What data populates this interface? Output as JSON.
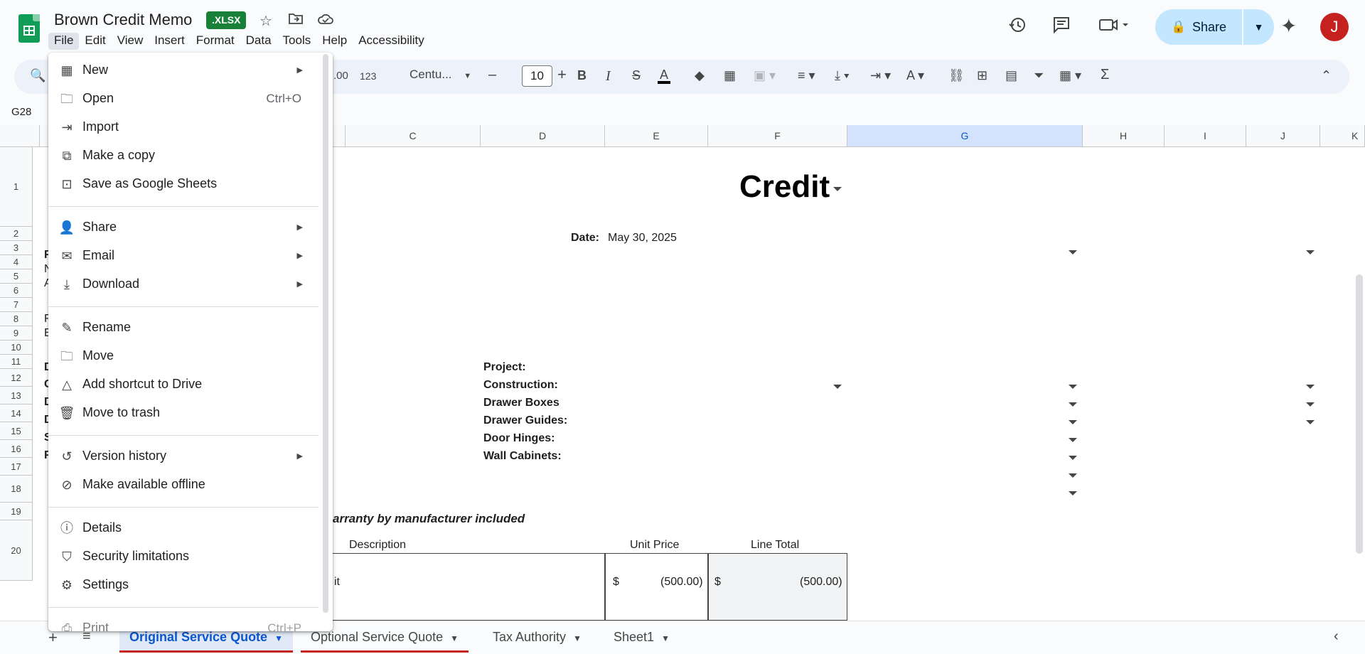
{
  "app": {
    "doc_title": "Brown Credit Memo",
    "format_badge": ".XLSX",
    "avatar_letter": "J",
    "share_label": "Share"
  },
  "menubar": [
    "File",
    "Edit",
    "View",
    "Insert",
    "Format",
    "Data",
    "Tools",
    "Help",
    "Accessibility"
  ],
  "toolbar": {
    "font_name": "Centu...",
    "font_size": "10",
    "number_format_label": "123",
    "decimal_label": ".00"
  },
  "namebox": "G28",
  "columns": [
    "C",
    "D",
    "E",
    "F",
    "G",
    "H",
    "I",
    "J",
    "K"
  ],
  "rows": [
    "1",
    "2",
    "3",
    "4",
    "5",
    "6",
    "7",
    "8",
    "9",
    "10",
    "11",
    "12",
    "13",
    "14",
    "15",
    "16",
    "17",
    "18",
    "19",
    "20"
  ],
  "sheet": {
    "title": "Credit",
    "date_label": "Date:",
    "date_value": "May 30, 2025",
    "fields": [
      "Project:",
      "Construction:",
      "Drawer Boxes",
      "Drawer Guides:",
      "Door Hinges:",
      "Wall Cabinets:"
    ],
    "warranty_note": "arranty by manufacturer included",
    "table_headers": [
      "Description",
      "Unit Price",
      "Line Total"
    ],
    "row20": {
      "desc_fragment": "it",
      "unit_currency": "$",
      "unit_value": "(500.00)",
      "line_currency": "$",
      "line_value": "(500.00)"
    },
    "left_fragments": [
      "F",
      "N",
      "A",
      "F",
      "E",
      "D",
      "C",
      "D",
      "D",
      "S",
      "F"
    ]
  },
  "tabs": [
    "Original Service Quote",
    "Optional Service Quote",
    "Tax Authority",
    "Sheet1"
  ],
  "file_menu": {
    "items": [
      {
        "label": "New",
        "icon": "new-sheet-icon",
        "submenu": true
      },
      {
        "label": "Open",
        "icon": "folder-icon",
        "shortcut": "Ctrl+O"
      },
      {
        "label": "Import",
        "icon": "import-icon"
      },
      {
        "label": "Make a copy",
        "icon": "copy-icon"
      },
      {
        "label": "Save as Google Sheets",
        "icon": "save-icon"
      },
      {
        "label": "Share",
        "icon": "share-person-icon",
        "submenu": true
      },
      {
        "label": "Email",
        "icon": "email-icon",
        "submenu": true
      },
      {
        "label": "Download",
        "icon": "download-icon",
        "submenu": true
      },
      {
        "label": "Rename",
        "icon": "pencil-icon"
      },
      {
        "label": "Move",
        "icon": "move-folder-icon"
      },
      {
        "label": "Add shortcut to Drive",
        "icon": "drive-shortcut-icon"
      },
      {
        "label": "Move to trash",
        "icon": "trash-icon"
      },
      {
        "label": "Version history",
        "icon": "history-icon",
        "submenu": true
      },
      {
        "label": "Make available offline",
        "icon": "offline-icon"
      },
      {
        "label": "Details",
        "icon": "info-icon"
      },
      {
        "label": "Security limitations",
        "icon": "shield-icon"
      },
      {
        "label": "Settings",
        "icon": "gear-icon"
      },
      {
        "label": "Print",
        "icon": "print-icon",
        "shortcut": "Ctrl+P"
      }
    ]
  }
}
